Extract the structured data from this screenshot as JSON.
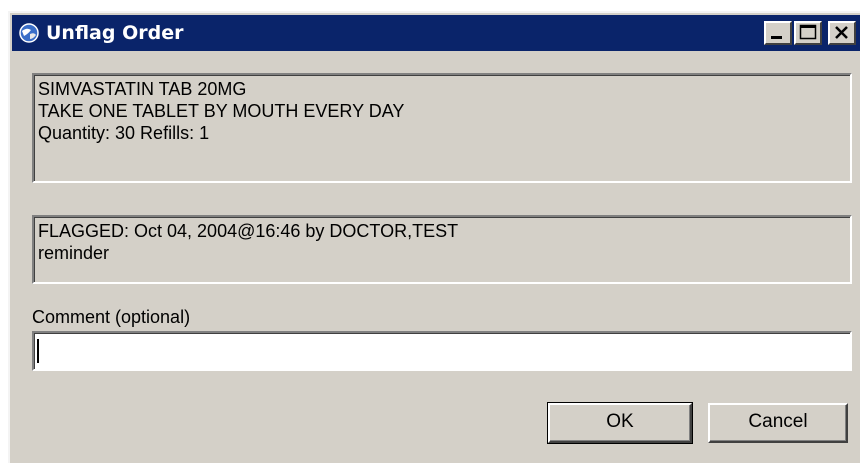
{
  "window": {
    "title": "Unflag Order",
    "controls": {
      "minimize_icon": "minimize-icon",
      "maximize_icon": "maximize-icon",
      "close_icon": "close-icon"
    },
    "titlebar_color": "#0a246a",
    "face_color": "#d4d0c8"
  },
  "order": {
    "drug": "SIMVASTATIN TAB  20MG",
    "sig": "TAKE ONE TABLET BY MOUTH EVERY DAY",
    "quantity_refills": "Quantity: 30 Refills: 1"
  },
  "flag": {
    "flagged_line": "FLAGGED: Oct 04, 2004@16:46 by DOCTOR,TEST",
    "reason": "reminder"
  },
  "comment": {
    "label": "Comment (optional)",
    "value": ""
  },
  "buttons": {
    "ok_label": "OK",
    "cancel_label": "Cancel"
  }
}
